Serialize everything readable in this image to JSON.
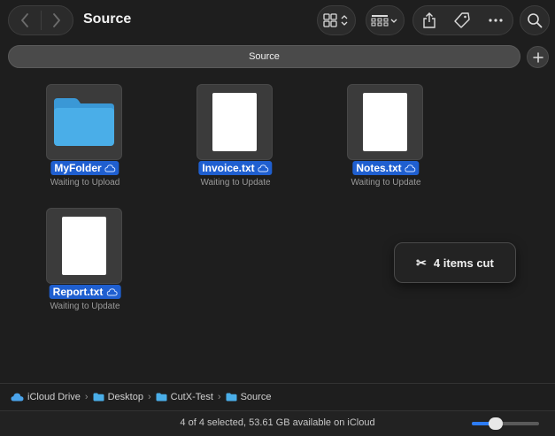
{
  "window": {
    "title": "Source"
  },
  "tab": {
    "label": "Source"
  },
  "files": [
    {
      "name": "MyFolder",
      "status": "Waiting to Upload",
      "kind": "folder"
    },
    {
      "name": "Invoice.txt",
      "status": "Waiting to Update",
      "kind": "text"
    },
    {
      "name": "Notes.txt",
      "status": "Waiting to Update",
      "kind": "text"
    },
    {
      "name": "Report.txt",
      "status": "Waiting to Update",
      "kind": "text"
    }
  ],
  "toast": {
    "label": "4 items cut",
    "icon": "scissors-icon"
  },
  "path": [
    {
      "label": "iCloud Drive",
      "icon": "icloud-icon"
    },
    {
      "label": "Desktop",
      "icon": "folder-icon"
    },
    {
      "label": "CutX-Test",
      "icon": "folder-icon"
    },
    {
      "label": "Source",
      "icon": "folder-icon"
    }
  ],
  "statusbar": {
    "text": "4 of 4 selected, 53.61 GB available on iCloud",
    "zoom_level": 0.35
  },
  "colors": {
    "selection": "#1f5fd0",
    "folder": "#4aaee8",
    "accent": "#2d7cf6"
  }
}
